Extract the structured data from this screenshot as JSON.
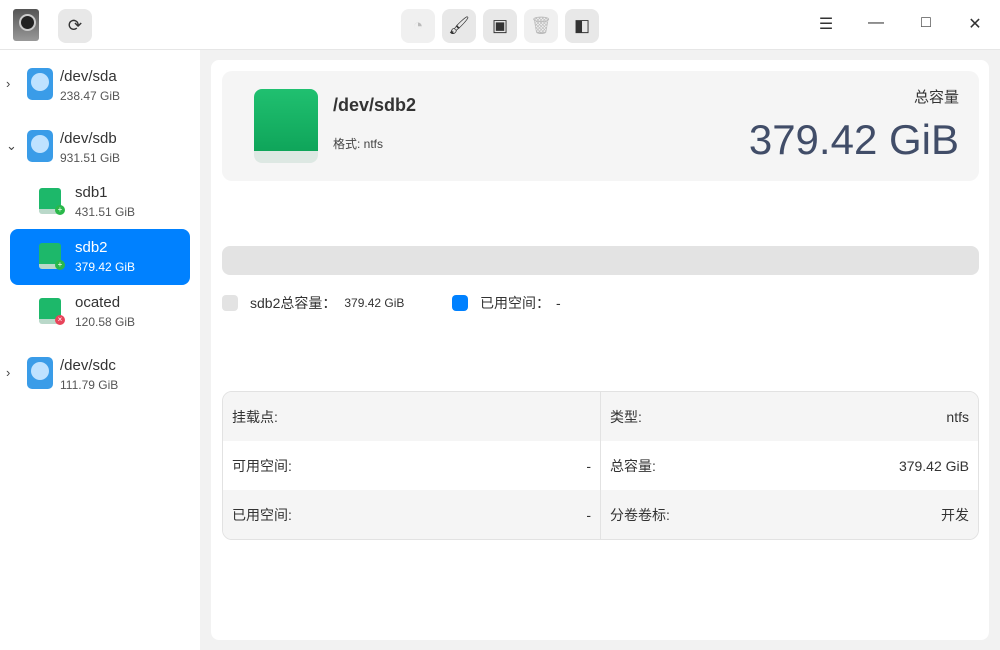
{
  "toolbar": {
    "refresh": "⟳",
    "partition": "◔",
    "wipe": "🖌",
    "mount": "▣",
    "delete": "🗑",
    "split": "◧"
  },
  "window": {
    "menu": "☰",
    "minimize": "—",
    "maximize": "□",
    "close": "✕"
  },
  "sidebar": {
    "disks": [
      {
        "name": "/dev/sda",
        "size": "238.47 GiB",
        "arrow": "›"
      },
      {
        "name": "/dev/sdb",
        "size": "931.51 GiB",
        "arrow": "⌄"
      },
      {
        "name": "/dev/sdc",
        "size": "111.79 GiB",
        "arrow": "›"
      }
    ],
    "partitions": [
      {
        "name": "sdb1",
        "size": "431.51 GiB",
        "badge": "+"
      },
      {
        "name": "sdb2",
        "size": "379.42 GiB",
        "badge": "+"
      },
      {
        "name": "ocated",
        "size": "120.58 GiB",
        "badge": "×"
      }
    ]
  },
  "header": {
    "name": "/dev/sdb2",
    "format": "格式: ntfs",
    "total_label": "总容量",
    "total": "379.42 GiB"
  },
  "usage": {
    "percent": 0,
    "legend_total_label": "sdb2总容量：",
    "legend_total": "379.42 GiB",
    "legend_used_label": "已用空间：",
    "legend_used": "-",
    "used_color": "#0081ff",
    "total_color": "#e3e3e3"
  },
  "info": [
    [
      {
        "k": "挂载点:",
        "v": ""
      },
      {
        "k": "类型:",
        "v": "ntfs"
      }
    ],
    [
      {
        "k": "可用空间:",
        "v": "-"
      },
      {
        "k": "总容量:",
        "v": "379.42 GiB"
      }
    ],
    [
      {
        "k": "已用空间:",
        "v": "-"
      },
      {
        "k": "分卷卷标:",
        "v": "开发"
      }
    ]
  ]
}
